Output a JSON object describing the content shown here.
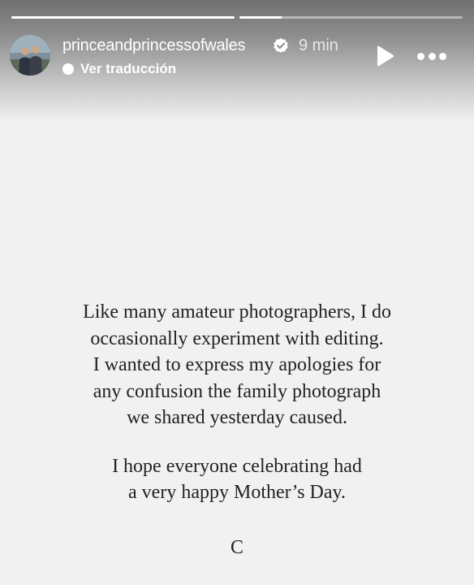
{
  "story": {
    "progress": [
      {
        "fraction": 1.0
      },
      {
        "fraction": 0.19
      }
    ],
    "header": {
      "username": "princeandprincessofwales",
      "verified": true,
      "time": "9 min",
      "translate_label": "Ver traducción",
      "avatar_icon": "profile-photo-icon",
      "play_icon": "play-icon",
      "more_icon": "more-options-icon"
    },
    "message": {
      "paragraph1": [
        "Like many amateur photographers, I do",
        "occasionally experiment with editing.",
        "I wanted to express my apologies for",
        "any confusion the family photograph",
        "we shared yesterday caused."
      ],
      "paragraph2": [
        "I hope everyone celebrating had",
        "a very happy Mother’s Day."
      ],
      "signature": "C"
    },
    "colors": {
      "background": "#f1f1f1",
      "text": "#222222",
      "header_text": "#ffffff",
      "verified_badge": "#ffffff"
    }
  }
}
